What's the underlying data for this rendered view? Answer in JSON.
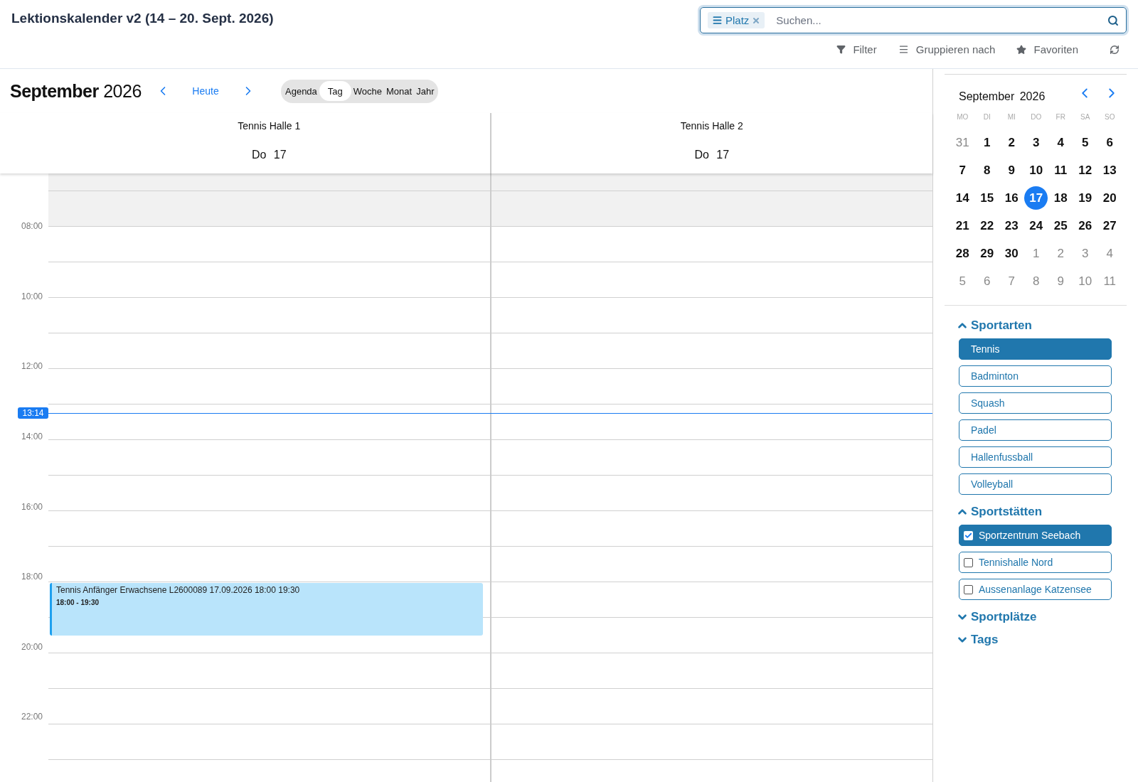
{
  "header": {
    "title": "Lektionskalender v2 (14 – 20. Sept. 2026)"
  },
  "search": {
    "facets": [
      {
        "label": "Platz"
      }
    ],
    "placeholder": "Suchen..."
  },
  "toolbar": [
    {
      "kind": "filter",
      "label": "Filter"
    },
    {
      "kind": "group",
      "label": "Gruppieren nach"
    },
    {
      "kind": "favorites",
      "label": "Favoriten"
    },
    {
      "kind": "refresh"
    }
  ],
  "calendar": {
    "month": "September",
    "year": "2026",
    "today_label": "Heute",
    "views": [
      {
        "label": "Agenda",
        "selected": false
      },
      {
        "label": "Tag",
        "selected": true
      },
      {
        "label": "Woche",
        "selected": false
      },
      {
        "label": "Monat",
        "selected": false
      },
      {
        "label": "Jahr",
        "selected": false
      }
    ],
    "resources": [
      {
        "name": "Tennis Halle 1",
        "day": "Do",
        "date": "17",
        "events": [
          {
            "title": "Tennis Anfänger Erwachsene L2600089 17.09.2026 18:00 19:30",
            "time": "18:00 - 19:30"
          }
        ]
      },
      {
        "name": "Tennis Halle 2",
        "day": "Do",
        "date": "17"
      }
    ],
    "time_labels": [
      "08:00",
      "10:00",
      "12:00",
      "14:00",
      "16:00",
      "18:00",
      "20:00",
      "22:00"
    ],
    "now": "13:14"
  },
  "mini_calendar": {
    "month": "September",
    "year": "2026",
    "weekdays": [
      "MO",
      "DI",
      "MI",
      "DO",
      "FR",
      "SA",
      "SO"
    ],
    "weeks": [
      [
        {
          "day": "31",
          "outside": true,
          "selected": false
        },
        {
          "day": "1",
          "outside": false,
          "selected": false
        },
        {
          "day": "2",
          "outside": false,
          "selected": false
        },
        {
          "day": "3",
          "outside": false,
          "selected": false
        },
        {
          "day": "4",
          "outside": false,
          "selected": false
        },
        {
          "day": "5",
          "outside": false,
          "selected": false
        },
        {
          "day": "6",
          "outside": false,
          "selected": false
        }
      ],
      [
        {
          "day": "7",
          "outside": false,
          "selected": false
        },
        {
          "day": "8",
          "outside": false,
          "selected": false
        },
        {
          "day": "9",
          "outside": false,
          "selected": false
        },
        {
          "day": "10",
          "outside": false,
          "selected": false
        },
        {
          "day": "11",
          "outside": false,
          "selected": false
        },
        {
          "day": "12",
          "outside": false,
          "selected": false
        },
        {
          "day": "13",
          "outside": false,
          "selected": false
        }
      ],
      [
        {
          "day": "14",
          "outside": false,
          "selected": false
        },
        {
          "day": "15",
          "outside": false,
          "selected": false
        },
        {
          "day": "16",
          "outside": false,
          "selected": false
        },
        {
          "day": "17",
          "outside": false,
          "selected": true
        },
        {
          "day": "18",
          "outside": false,
          "selected": false
        },
        {
          "day": "19",
          "outside": false,
          "selected": false
        },
        {
          "day": "20",
          "outside": false,
          "selected": false
        }
      ],
      [
        {
          "day": "21",
          "outside": false,
          "selected": false
        },
        {
          "day": "22",
          "outside": false,
          "selected": false
        },
        {
          "day": "23",
          "outside": false,
          "selected": false
        },
        {
          "day": "24",
          "outside": false,
          "selected": false
        },
        {
          "day": "25",
          "outside": false,
          "selected": false
        },
        {
          "day": "26",
          "outside": false,
          "selected": false
        },
        {
          "day": "27",
          "outside": false,
          "selected": false
        }
      ],
      [
        {
          "day": "28",
          "outside": false,
          "selected": false
        },
        {
          "day": "29",
          "outside": false,
          "selected": false
        },
        {
          "day": "30",
          "outside": false,
          "selected": false
        },
        {
          "day": "1",
          "outside": true,
          "selected": false
        },
        {
          "day": "2",
          "outside": true,
          "selected": false
        },
        {
          "day": "3",
          "outside": true,
          "selected": false
        },
        {
          "day": "4",
          "outside": true,
          "selected": false
        }
      ],
      [
        {
          "day": "5",
          "outside": true,
          "selected": false
        },
        {
          "day": "6",
          "outside": true,
          "selected": false
        },
        {
          "day": "7",
          "outside": true,
          "selected": false
        },
        {
          "day": "8",
          "outside": true,
          "selected": false
        },
        {
          "day": "9",
          "outside": true,
          "selected": false
        },
        {
          "day": "10",
          "outside": true,
          "selected": false
        },
        {
          "day": "11",
          "outside": true,
          "selected": false
        }
      ]
    ]
  },
  "filters": [
    {
      "title": "Sportarten",
      "expanded": true,
      "kind": "buttons",
      "items": [
        {
          "label": "Tennis",
          "selected": true
        },
        {
          "label": "Badminton",
          "selected": false
        },
        {
          "label": "Squash",
          "selected": false
        },
        {
          "label": "Padel",
          "selected": false
        },
        {
          "label": "Hallenfussball",
          "selected": false
        },
        {
          "label": "Volleyball",
          "selected": false
        }
      ]
    },
    {
      "title": "Sportstätten",
      "expanded": true,
      "kind": "checkboxes",
      "items": [
        {
          "label": "Sportzentrum Seebach",
          "checked": true
        },
        {
          "label": "Tennishalle Nord",
          "checked": false
        },
        {
          "label": "Aussenanlage Katzensee",
          "checked": false
        }
      ]
    },
    {
      "title": "Sportplätze",
      "expanded": false
    },
    {
      "title": "Tags",
      "expanded": false
    }
  ]
}
